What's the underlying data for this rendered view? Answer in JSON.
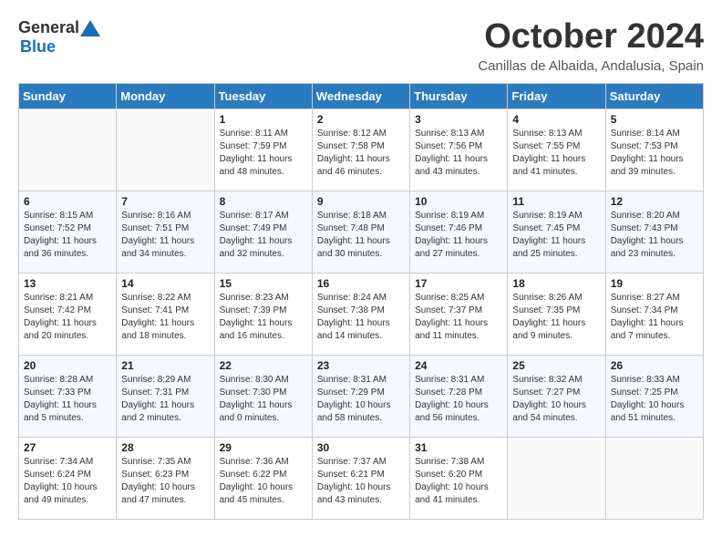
{
  "header": {
    "logo_general": "General",
    "logo_blue": "Blue",
    "month_title": "October 2024",
    "location": "Canillas de Albaida, Andalusia, Spain"
  },
  "days_of_week": [
    "Sunday",
    "Monday",
    "Tuesday",
    "Wednesday",
    "Thursday",
    "Friday",
    "Saturday"
  ],
  "weeks": [
    [
      {
        "day": "",
        "sunrise": "",
        "sunset": "",
        "daylight": ""
      },
      {
        "day": "",
        "sunrise": "",
        "sunset": "",
        "daylight": ""
      },
      {
        "day": "1",
        "sunrise": "Sunrise: 8:11 AM",
        "sunset": "Sunset: 7:59 PM",
        "daylight": "Daylight: 11 hours and 48 minutes."
      },
      {
        "day": "2",
        "sunrise": "Sunrise: 8:12 AM",
        "sunset": "Sunset: 7:58 PM",
        "daylight": "Daylight: 11 hours and 46 minutes."
      },
      {
        "day": "3",
        "sunrise": "Sunrise: 8:13 AM",
        "sunset": "Sunset: 7:56 PM",
        "daylight": "Daylight: 11 hours and 43 minutes."
      },
      {
        "day": "4",
        "sunrise": "Sunrise: 8:13 AM",
        "sunset": "Sunset: 7:55 PM",
        "daylight": "Daylight: 11 hours and 41 minutes."
      },
      {
        "day": "5",
        "sunrise": "Sunrise: 8:14 AM",
        "sunset": "Sunset: 7:53 PM",
        "daylight": "Daylight: 11 hours and 39 minutes."
      }
    ],
    [
      {
        "day": "6",
        "sunrise": "Sunrise: 8:15 AM",
        "sunset": "Sunset: 7:52 PM",
        "daylight": "Daylight: 11 hours and 36 minutes."
      },
      {
        "day": "7",
        "sunrise": "Sunrise: 8:16 AM",
        "sunset": "Sunset: 7:51 PM",
        "daylight": "Daylight: 11 hours and 34 minutes."
      },
      {
        "day": "8",
        "sunrise": "Sunrise: 8:17 AM",
        "sunset": "Sunset: 7:49 PM",
        "daylight": "Daylight: 11 hours and 32 minutes."
      },
      {
        "day": "9",
        "sunrise": "Sunrise: 8:18 AM",
        "sunset": "Sunset: 7:48 PM",
        "daylight": "Daylight: 11 hours and 30 minutes."
      },
      {
        "day": "10",
        "sunrise": "Sunrise: 8:19 AM",
        "sunset": "Sunset: 7:46 PM",
        "daylight": "Daylight: 11 hours and 27 minutes."
      },
      {
        "day": "11",
        "sunrise": "Sunrise: 8:19 AM",
        "sunset": "Sunset: 7:45 PM",
        "daylight": "Daylight: 11 hours and 25 minutes."
      },
      {
        "day": "12",
        "sunrise": "Sunrise: 8:20 AM",
        "sunset": "Sunset: 7:43 PM",
        "daylight": "Daylight: 11 hours and 23 minutes."
      }
    ],
    [
      {
        "day": "13",
        "sunrise": "Sunrise: 8:21 AM",
        "sunset": "Sunset: 7:42 PM",
        "daylight": "Daylight: 11 hours and 20 minutes."
      },
      {
        "day": "14",
        "sunrise": "Sunrise: 8:22 AM",
        "sunset": "Sunset: 7:41 PM",
        "daylight": "Daylight: 11 hours and 18 minutes."
      },
      {
        "day": "15",
        "sunrise": "Sunrise: 8:23 AM",
        "sunset": "Sunset: 7:39 PM",
        "daylight": "Daylight: 11 hours and 16 minutes."
      },
      {
        "day": "16",
        "sunrise": "Sunrise: 8:24 AM",
        "sunset": "Sunset: 7:38 PM",
        "daylight": "Daylight: 11 hours and 14 minutes."
      },
      {
        "day": "17",
        "sunrise": "Sunrise: 8:25 AM",
        "sunset": "Sunset: 7:37 PM",
        "daylight": "Daylight: 11 hours and 11 minutes."
      },
      {
        "day": "18",
        "sunrise": "Sunrise: 8:26 AM",
        "sunset": "Sunset: 7:35 PM",
        "daylight": "Daylight: 11 hours and 9 minutes."
      },
      {
        "day": "19",
        "sunrise": "Sunrise: 8:27 AM",
        "sunset": "Sunset: 7:34 PM",
        "daylight": "Daylight: 11 hours and 7 minutes."
      }
    ],
    [
      {
        "day": "20",
        "sunrise": "Sunrise: 8:28 AM",
        "sunset": "Sunset: 7:33 PM",
        "daylight": "Daylight: 11 hours and 5 minutes."
      },
      {
        "day": "21",
        "sunrise": "Sunrise: 8:29 AM",
        "sunset": "Sunset: 7:31 PM",
        "daylight": "Daylight: 11 hours and 2 minutes."
      },
      {
        "day": "22",
        "sunrise": "Sunrise: 8:30 AM",
        "sunset": "Sunset: 7:30 PM",
        "daylight": "Daylight: 11 hours and 0 minutes."
      },
      {
        "day": "23",
        "sunrise": "Sunrise: 8:31 AM",
        "sunset": "Sunset: 7:29 PM",
        "daylight": "Daylight: 10 hours and 58 minutes."
      },
      {
        "day": "24",
        "sunrise": "Sunrise: 8:31 AM",
        "sunset": "Sunset: 7:28 PM",
        "daylight": "Daylight: 10 hours and 56 minutes."
      },
      {
        "day": "25",
        "sunrise": "Sunrise: 8:32 AM",
        "sunset": "Sunset: 7:27 PM",
        "daylight": "Daylight: 10 hours and 54 minutes."
      },
      {
        "day": "26",
        "sunrise": "Sunrise: 8:33 AM",
        "sunset": "Sunset: 7:25 PM",
        "daylight": "Daylight: 10 hours and 51 minutes."
      }
    ],
    [
      {
        "day": "27",
        "sunrise": "Sunrise: 7:34 AM",
        "sunset": "Sunset: 6:24 PM",
        "daylight": "Daylight: 10 hours and 49 minutes."
      },
      {
        "day": "28",
        "sunrise": "Sunrise: 7:35 AM",
        "sunset": "Sunset: 6:23 PM",
        "daylight": "Daylight: 10 hours and 47 minutes."
      },
      {
        "day": "29",
        "sunrise": "Sunrise: 7:36 AM",
        "sunset": "Sunset: 6:22 PM",
        "daylight": "Daylight: 10 hours and 45 minutes."
      },
      {
        "day": "30",
        "sunrise": "Sunrise: 7:37 AM",
        "sunset": "Sunset: 6:21 PM",
        "daylight": "Daylight: 10 hours and 43 minutes."
      },
      {
        "day": "31",
        "sunrise": "Sunrise: 7:38 AM",
        "sunset": "Sunset: 6:20 PM",
        "daylight": "Daylight: 10 hours and 41 minutes."
      },
      {
        "day": "",
        "sunrise": "",
        "sunset": "",
        "daylight": ""
      },
      {
        "day": "",
        "sunrise": "",
        "sunset": "",
        "daylight": ""
      }
    ]
  ]
}
